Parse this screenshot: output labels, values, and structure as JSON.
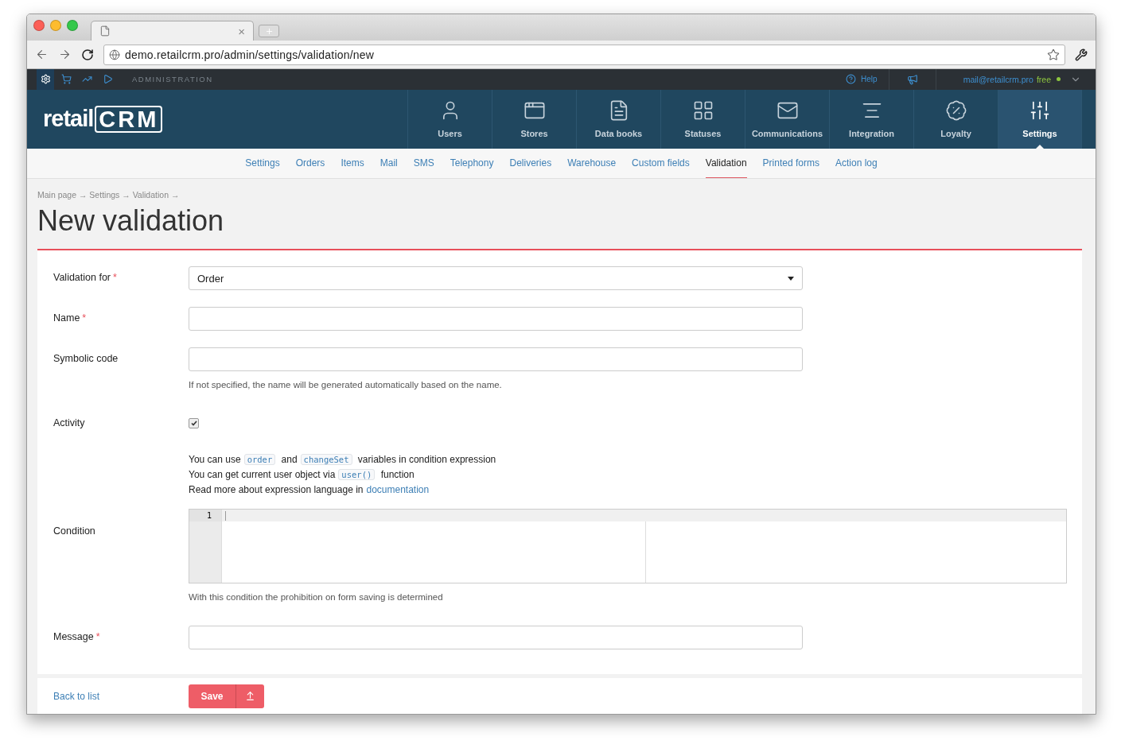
{
  "browser": {
    "tab_close": "×",
    "url": "demo.retailcrm.pro/admin/settings/validation/new"
  },
  "admin_bar": {
    "apps": [
      {
        "kind": "settings",
        "selected": true
      },
      {
        "kind": "cart",
        "selected": false
      },
      {
        "kind": "analytics",
        "selected": false
      },
      {
        "kind": "play",
        "selected": false
      }
    ],
    "label": "ADMINISTRATION",
    "help": "Help",
    "email": "mail@retailcrm.pro",
    "plan": "free"
  },
  "logo": {
    "text": "retail",
    "mark": "CRM"
  },
  "nav": [
    {
      "kind": "users",
      "label": "Users",
      "selected": false
    },
    {
      "kind": "stores",
      "label": "Stores",
      "selected": false
    },
    {
      "kind": "books",
      "label": "Data books",
      "selected": false
    },
    {
      "kind": "statuses",
      "label": "Statuses",
      "selected": false
    },
    {
      "kind": "communications",
      "label": "Communications",
      "selected": false
    },
    {
      "kind": "integration",
      "label": "Integration",
      "selected": false
    },
    {
      "kind": "loyalty",
      "label": "Loyalty",
      "selected": false
    },
    {
      "kind": "settings",
      "label": "Settings",
      "selected": true
    }
  ],
  "subnav": [
    {
      "label": "Settings",
      "selected": false
    },
    {
      "label": "Orders",
      "selected": false
    },
    {
      "label": "Items",
      "selected": false
    },
    {
      "label": "Mail",
      "selected": false
    },
    {
      "label": "SMS",
      "selected": false
    },
    {
      "label": "Telephony",
      "selected": false
    },
    {
      "label": "Deliveries",
      "selected": false
    },
    {
      "label": "Warehouse",
      "selected": false
    },
    {
      "label": "Custom fields",
      "selected": false
    },
    {
      "label": "Validation",
      "selected": true
    },
    {
      "label": "Printed forms",
      "selected": false
    },
    {
      "label": "Action log",
      "selected": false
    }
  ],
  "required_mark": "*",
  "breadcrumbs": "Main page → Settings → Validation →",
  "title": "New validation",
  "fields": [
    {
      "kind": "select",
      "label": "Validation for",
      "required": true,
      "value": "Order"
    },
    {
      "kind": "text",
      "label": "Name",
      "required": true
    },
    {
      "kind": "text",
      "label": "Symbolic code",
      "required": false,
      "hint": "If not specified, the name will be generated automatically based on the name."
    },
    {
      "kind": "checkbox",
      "label": "Activity",
      "required": false,
      "checked": true
    },
    {
      "kind": "editor",
      "label": "Condition",
      "required": false,
      "help": [
        [
          {
            "kind": "text",
            "text": "You can use"
          },
          {
            "kind": "code",
            "text": "order"
          },
          {
            "kind": "text",
            "text": "and"
          },
          {
            "kind": "code",
            "text": "changeSet"
          },
          {
            "kind": "text",
            "text": "variables in condition expression"
          }
        ],
        [
          {
            "kind": "text",
            "text": "You can get current user object via"
          },
          {
            "kind": "code",
            "text": "user()"
          },
          {
            "kind": "text",
            "text": "function"
          }
        ],
        [
          {
            "kind": "text",
            "text": "Read more about expression language in"
          },
          {
            "kind": "link",
            "text": "documentation"
          }
        ]
      ],
      "line_numbers": [
        "1"
      ],
      "hint": "With this condition the prohibition on form saving is determined"
    },
    {
      "kind": "text",
      "label": "Message",
      "required": true
    }
  ],
  "footer": {
    "back": "Back to list",
    "save": "Save"
  }
}
